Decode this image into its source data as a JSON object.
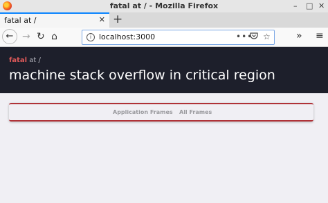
{
  "window": {
    "title": "fatal at / - Mozilla Firefox",
    "controls": {
      "minimize": "–",
      "maximize": "□",
      "close": "✕"
    }
  },
  "tabs": [
    {
      "title": "fatal at /",
      "close": "✕"
    }
  ],
  "new_tab_label": "+",
  "navigation": {
    "back": "←",
    "forward": "→",
    "reload": "↻",
    "home": "⌂",
    "url": "localhost:3000",
    "overflow_label": "»"
  },
  "page": {
    "level": "fatal",
    "path": "at /",
    "message": "machine stack overflow in critical region",
    "frame_tabs": [
      "Application Frames",
      "All Frames"
    ]
  },
  "colors": {
    "header_bg": "#1d1f2b",
    "level_color": "#e05a5a",
    "frames_border": "#b03238",
    "firefox_accent": "#0a84ff"
  }
}
